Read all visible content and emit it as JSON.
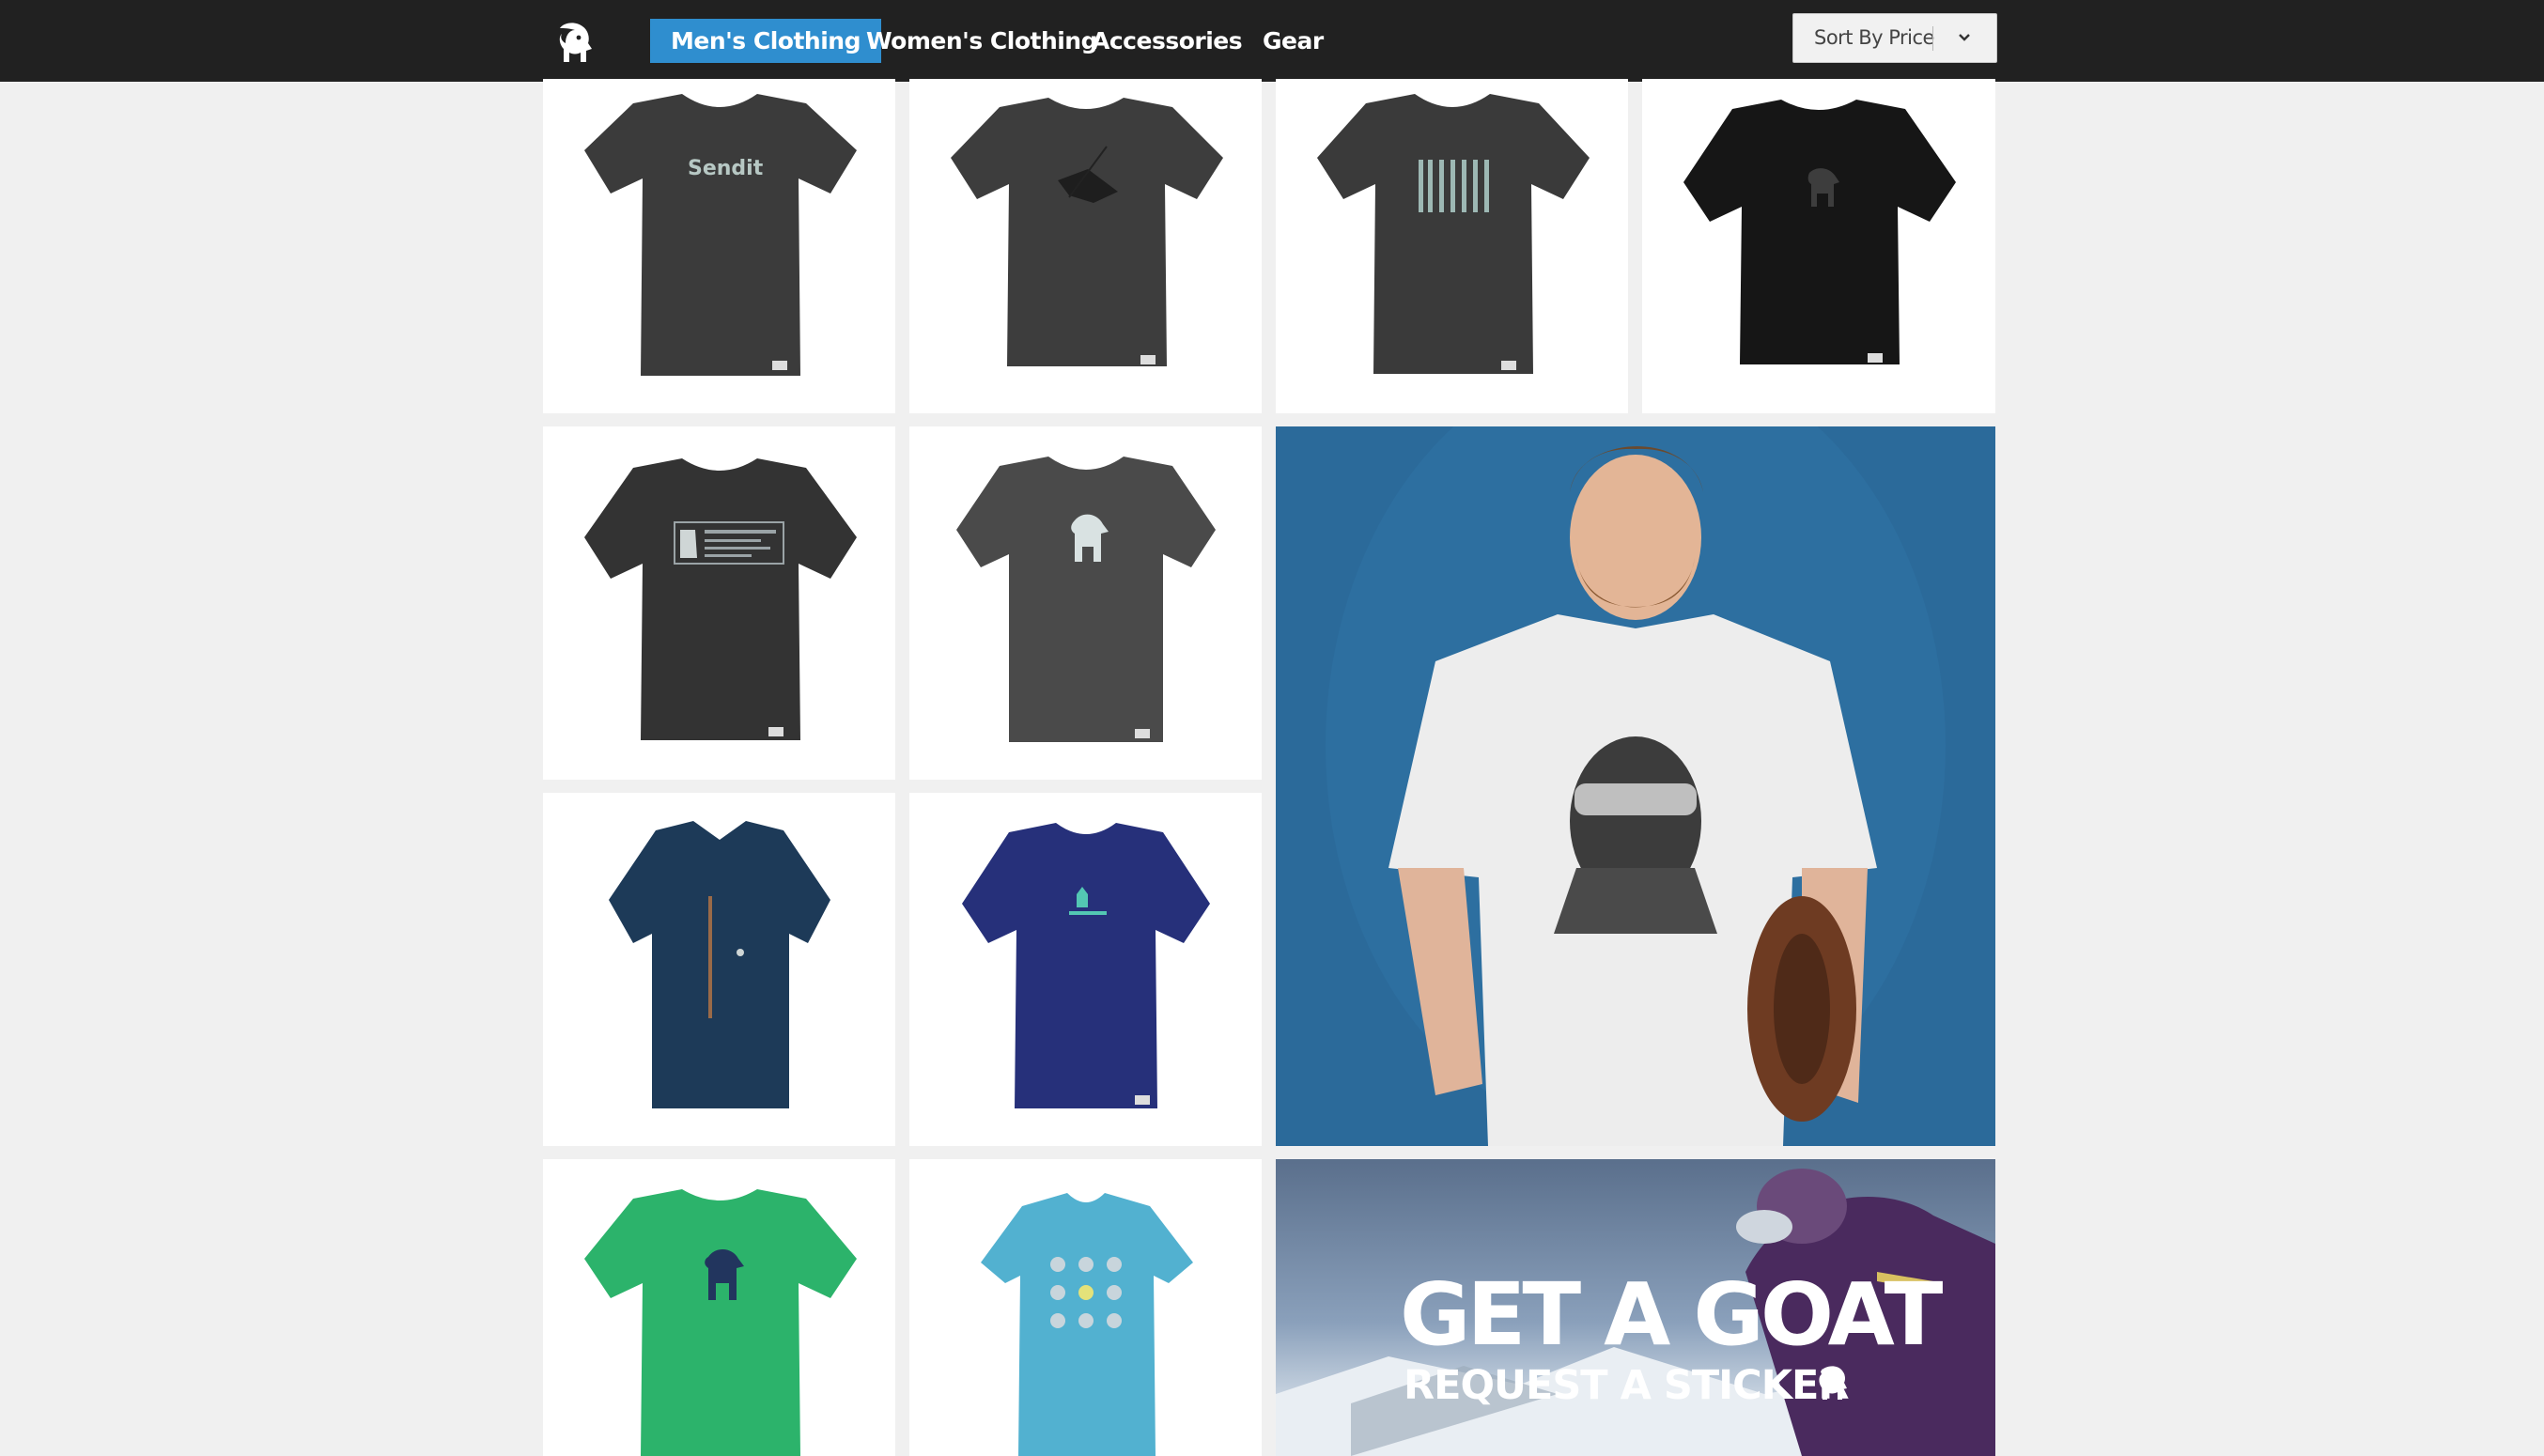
{
  "nav": {
    "logo_icon": "goat-logo-icon",
    "items": [
      {
        "label": "Men's Clothing",
        "active": true
      },
      {
        "label": "Women's Clothing",
        "active": false
      },
      {
        "label": "Accessories",
        "active": false
      },
      {
        "label": "Gear",
        "active": false
      }
    ],
    "sort": {
      "label": "Sort By Price",
      "icon": "chevron-down-icon"
    }
  },
  "products": [
    {
      "name": "Send It tee",
      "print_text": "Sendit",
      "color": "#3b3b3b"
    },
    {
      "name": "Skier silhouette tee",
      "color": "#3d3d3d"
    },
    {
      "name": "Skis tee",
      "color": "#3a3a3a"
    },
    {
      "name": "Black goat tee",
      "color": "#161616"
    },
    {
      "name": "Goat badge tee",
      "color": "#333333"
    },
    {
      "name": "Goat logo tee",
      "color": "#4a4a4a"
    },
    {
      "name": "Button-up shirt",
      "color": "#1d3a58"
    },
    {
      "name": "Navy pocket tee",
      "color": "#26307a"
    },
    {
      "name": "Green goat tee",
      "color": "#2cb36b"
    },
    {
      "name": "Baby onesie",
      "color": "#52b1d0"
    }
  ],
  "hero": {
    "name": "Abraham Lincoln ski goggle tee model",
    "background": "#2b6a9a"
  },
  "promo": {
    "title": "GET A GOAT",
    "subtitle": "REQUEST A STICKER"
  },
  "colors": {
    "topbar": "#212121",
    "accent": "#2f8ecf",
    "page_bg": "#f0f0f0"
  }
}
